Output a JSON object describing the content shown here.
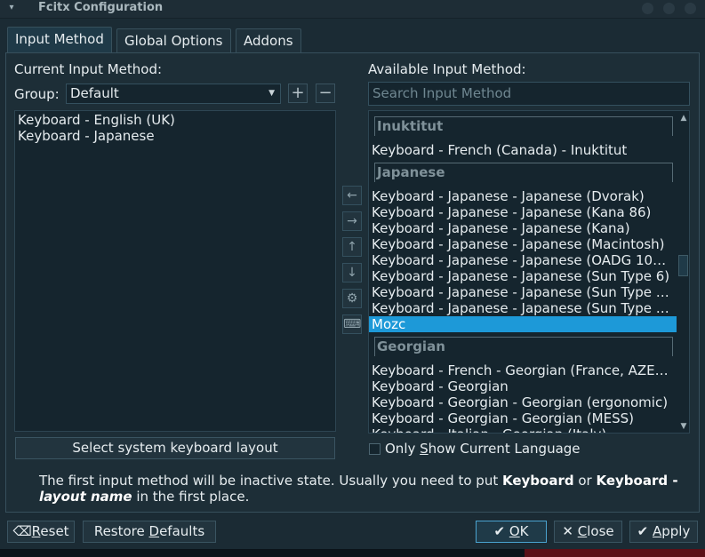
{
  "window": {
    "title": "Fcitx Configuration"
  },
  "tabs": [
    {
      "label": "Input Method",
      "active": true
    },
    {
      "label": "Global Options",
      "active": false
    },
    {
      "label": "Addons",
      "active": false
    }
  ],
  "current": {
    "heading": "Current Input Method:",
    "group_label": "Group:",
    "group_value": "Default",
    "add_glyph": "+",
    "remove_glyph": "−",
    "items": [
      "Keyboard - English (UK)",
      "Keyboard - Japanese"
    ],
    "select_layout_button": "Select system keyboard layout"
  },
  "available": {
    "heading": "Available Input Method:",
    "search_placeholder": "Search Input Method",
    "groups": [
      {
        "header": "Inuktitut",
        "items": [
          "Keyboard - French (Canada) - Inuktitut"
        ]
      },
      {
        "header": "Japanese",
        "items": [
          "Keyboard - Japanese - Japanese (Dvorak)",
          "Keyboard - Japanese - Japanese (Kana 86)",
          "Keyboard - Japanese - Japanese (Kana)",
          "Keyboard - Japanese - Japanese (Macintosh)",
          "Keyboard - Japanese - Japanese (OADG 10…",
          "Keyboard - Japanese - Japanese (Sun Type 6)",
          "Keyboard - Japanese - Japanese (Sun Type …",
          "Keyboard - Japanese - Japanese (Sun Type …",
          "Mozc"
        ]
      },
      {
        "header": "Georgian",
        "items": [
          "Keyboard - French - Georgian (France, AZE…",
          "Keyboard - Georgian",
          "Keyboard - Georgian - Georgian (ergonomic)",
          "Keyboard - Georgian - Georgian (MESS)",
          "Keyboard - Italian - Georgian (Italy)"
        ]
      }
    ],
    "selected_item": "Mozc",
    "only_current_prefix": "Only ",
    "only_current_key": "S",
    "only_current_suffix": "how Current Language"
  },
  "info": {
    "t1": "The first input method will be inactive state. Usually you need to put ",
    "b1": "Keyboard",
    "t2": " or ",
    "b2": "Keyboard - ",
    "b3": "layout name",
    "t3": " in the first place."
  },
  "buttons": {
    "reset_key": "R",
    "reset_rest": "eset",
    "restore_pre": "Restore ",
    "restore_key": "D",
    "restore_rest": "efaults",
    "ok_key": "O",
    "ok_rest": "K",
    "close_key": "C",
    "close_rest": "lose",
    "apply_key": "A",
    "apply_rest": "pply"
  },
  "icons": {
    "ok": "check-icon",
    "close": "x-icon",
    "reset": "backspace-icon",
    "side": [
      "arrow-left-icon",
      "arrow-right-icon",
      "arrow-up-icon",
      "arrow-down-icon",
      "gear-icon",
      "keyboard-icon"
    ]
  },
  "colors": {
    "selection": "#1d99d8",
    "background": "#1b2b34"
  }
}
